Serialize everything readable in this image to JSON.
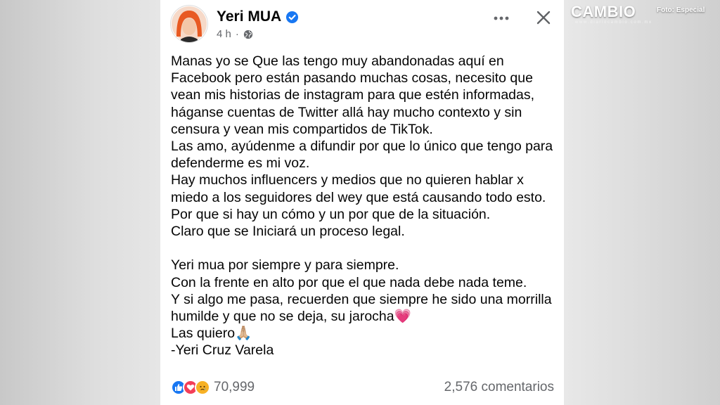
{
  "watermark": {
    "brand": "CAMBIO",
    "brand_sub": "w w w . d i a r i o c a m b i o . c o m . m x",
    "credit": "Foto: Especial"
  },
  "post": {
    "author": "Yeri MUA",
    "verified_icon": "verified-badge-icon",
    "time": "4 h",
    "separator": "·",
    "privacy_icon": "globe-icon",
    "more_icon": "more-horizontal-icon",
    "close_icon": "close-icon",
    "paragraphs": [
      "Manas yo se Que las tengo muy abandonadas aquí en Facebook pero están pasando muchas cosas, necesito que vean mis historias de instagram para que estén informadas, háganse cuentas de Twitter allá hay mucho contexto y sin censura y vean mis compartidos de TikTok.",
      "Las amo, ayúdenme a difundir por que lo único que tengo para defenderme es mi voz.",
      "Hay muchos influencers y medios que no quieren hablar x miedo a los seguidores del wey que está causando todo esto.",
      "Por que si hay un cómo y un por que de la situación.",
      "Claro que se Iniciará un proceso legal.",
      "",
      "Yeri mua por siempre y para siempre.",
      "Con la frente en alto por que el que nada debe nada teme.",
      "Y si algo me pasa, recuerden que siempre he sido una morrilla humilde y que no se deja, su jarocha💗",
      "Las quiero🙏🏼",
      "-Yeri Cruz Varela"
    ],
    "reactions": {
      "icons": [
        "like-icon",
        "love-icon",
        "sad-icon"
      ],
      "count": "70,999"
    },
    "comments": "2,576 comentarios"
  },
  "colors": {
    "verified": "#1877f2",
    "like": "#1877f2",
    "love": "#f33e58",
    "sad": "#f7b125",
    "secondary_text": "#65676b"
  }
}
